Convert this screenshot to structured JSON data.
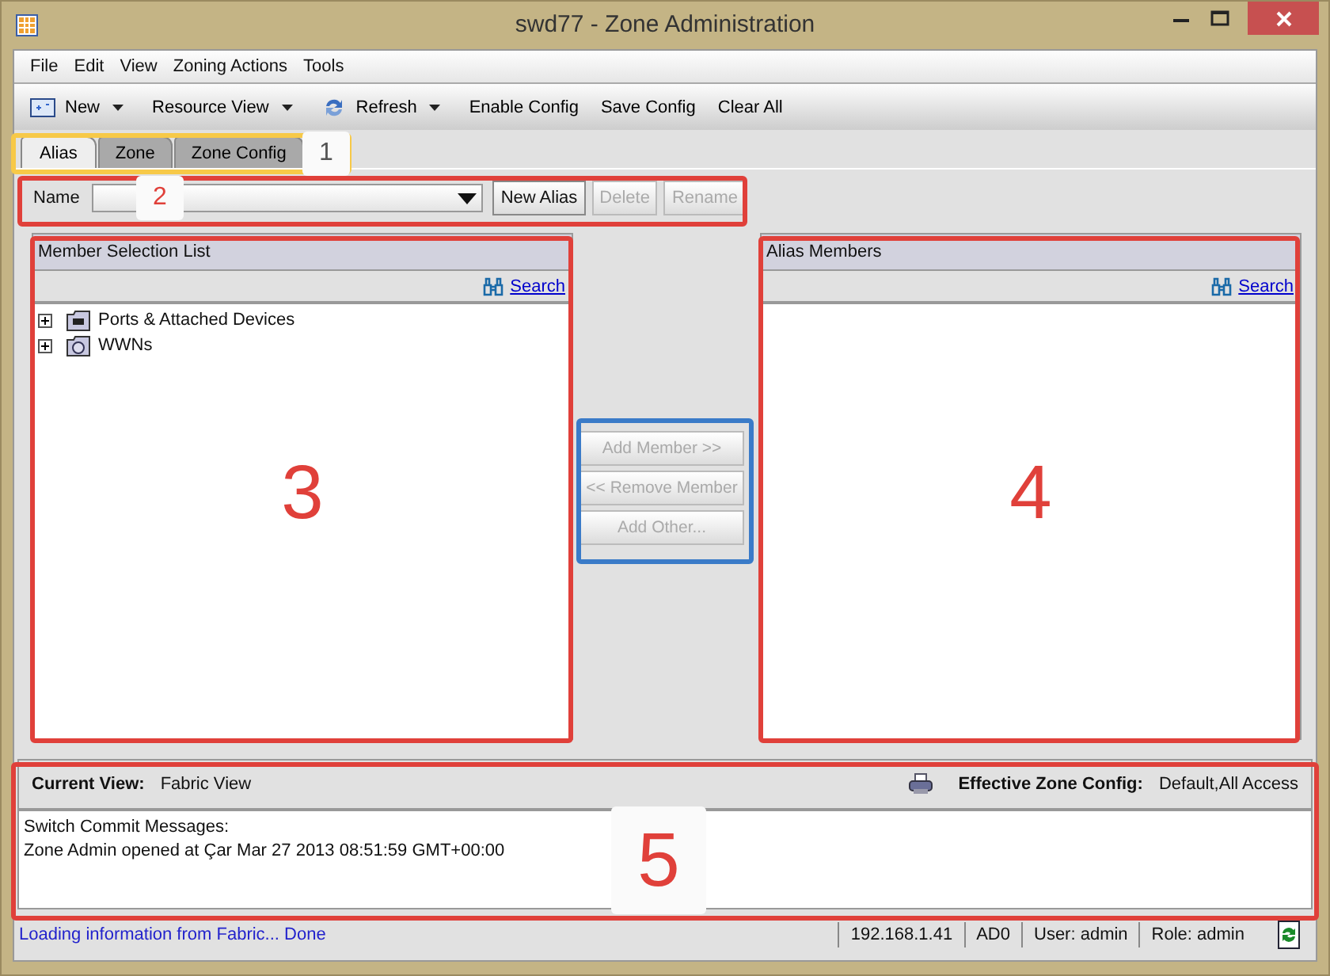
{
  "window": {
    "title": "swd77 - Zone Administration"
  },
  "menu": [
    "File",
    "Edit",
    "View",
    "Zoning Actions",
    "Tools"
  ],
  "toolbar": [
    {
      "kind": "dropdown",
      "label": "New"
    },
    {
      "kind": "dropdown",
      "label": "Resource View"
    },
    {
      "kind": "dropdown",
      "label": "Refresh"
    },
    {
      "kind": "plain",
      "label": "Enable Config"
    },
    {
      "kind": "plain",
      "label": "Save Config"
    },
    {
      "kind": "plain",
      "label": "Clear All"
    }
  ],
  "tabs": [
    {
      "label": "Alias",
      "selected": true
    },
    {
      "label": "Zone",
      "selected": false
    },
    {
      "label": "Zone Config",
      "selected": false
    }
  ],
  "name_row": {
    "label": "Name",
    "buttons": [
      {
        "label": "New Alias",
        "disabled": false
      },
      {
        "label": "Delete",
        "disabled": true
      },
      {
        "label": "Rename",
        "disabled": true
      }
    ]
  },
  "left_panel": {
    "title": "Member Selection List",
    "search": "Search",
    "tree": [
      {
        "label": "Ports & Attached Devices",
        "expanded": false
      },
      {
        "label": "WWNs",
        "expanded": false
      }
    ]
  },
  "center_buttons": [
    {
      "label": "Add Member >>",
      "disabled": true
    },
    {
      "label": "<< Remove Member",
      "disabled": true
    },
    {
      "label": "Add Other...",
      "disabled": true
    }
  ],
  "right_panel": {
    "title": "Alias Members",
    "search": "Search"
  },
  "bottom": {
    "current_view_label": "Current View:",
    "current_view": "Fabric View",
    "effective_label": "Effective Zone Config:",
    "effective": "Default,All Access",
    "messages": [
      "Switch Commit Messages:",
      "Zone Admin opened at Çar Mar 27 2013 08:51:59 GMT+00:00"
    ]
  },
  "status_bar": {
    "message": "Loading information from Fabric... Done",
    "fields": [
      "192.168.1.41",
      "AD0",
      "User: admin",
      "Role: admin"
    ]
  },
  "annotations": [
    {
      "label": "1",
      "color": "#f7c948"
    },
    {
      "label": "2",
      "color": "#e0403a"
    },
    {
      "label": "3",
      "color": "#e0403a"
    },
    {
      "label": "4",
      "color": "#e0403a"
    },
    {
      "label": "5",
      "color": "#e0403a"
    },
    {
      "color": "#3a7bc8"
    }
  ]
}
